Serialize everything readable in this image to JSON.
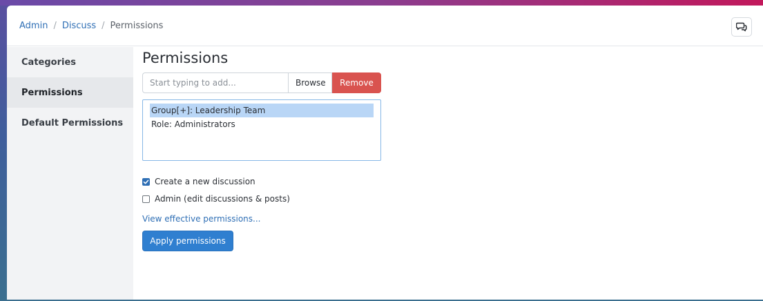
{
  "breadcrumb": {
    "items": [
      "Admin",
      "Discuss"
    ],
    "separator": "/",
    "current": "Permissions"
  },
  "header": {
    "chat_icon": "chat-bubbles-icon"
  },
  "sidebar": {
    "items": [
      {
        "label": "Categories",
        "active": false
      },
      {
        "label": "Permissions",
        "active": true
      },
      {
        "label": "Default Permissions",
        "active": false
      }
    ]
  },
  "main": {
    "title": "Permissions",
    "add_input": {
      "placeholder": "Start typing to add...",
      "value": ""
    },
    "browse_label": "Browse",
    "remove_label": "Remove",
    "list_options": [
      {
        "label": "Group[+]: Leadership Team",
        "selected": true
      },
      {
        "label": "Role: Administrators",
        "selected": false
      }
    ],
    "checkboxes": [
      {
        "label": "Create a new discussion",
        "checked": true
      },
      {
        "label": "Admin (edit discussions & posts)",
        "checked": false
      }
    ],
    "view_link": "View effective permissions...",
    "apply_label": "Apply permissions"
  },
  "colors": {
    "accent": "#2f6fb5",
    "danger": "#d9534f",
    "primary_button": "#2f7fd0",
    "selection": "#b9d6f6"
  }
}
